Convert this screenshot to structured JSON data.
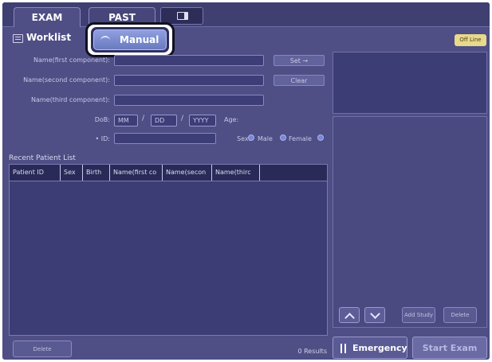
{
  "tabs": {
    "exam": "EXAM",
    "past": "PAST"
  },
  "subheader": {
    "worklist": "Worklist",
    "manual": "Manual",
    "offline": "Off Line"
  },
  "form": {
    "name_first_label": "Name(first component):",
    "name_second_label": "Name(second component):",
    "name_third_label": "Name(third component):",
    "dob_label": "DoB:",
    "dob_month_placeholder": "MM",
    "dob_day_placeholder": "DD",
    "dob_year_placeholder": "YYYY",
    "age_label": "Age:",
    "id_label": "• ID:",
    "sex_label": "Sex:",
    "sex_male": "Male",
    "sex_female": "Female",
    "set_button": "Set →",
    "clear_button": "Clear"
  },
  "recent": {
    "title": "Recent Patient List",
    "columns": [
      "Patient ID",
      "Sex",
      "Birth",
      "Name(first co",
      "Name(secon",
      "Name(thirc"
    ]
  },
  "side": {
    "add_study": "Add Study",
    "delete": "Delete"
  },
  "footer": {
    "delete": "Delete",
    "results": "0 Results",
    "emergency": "Emergency",
    "start_exam": "Start Exam"
  }
}
